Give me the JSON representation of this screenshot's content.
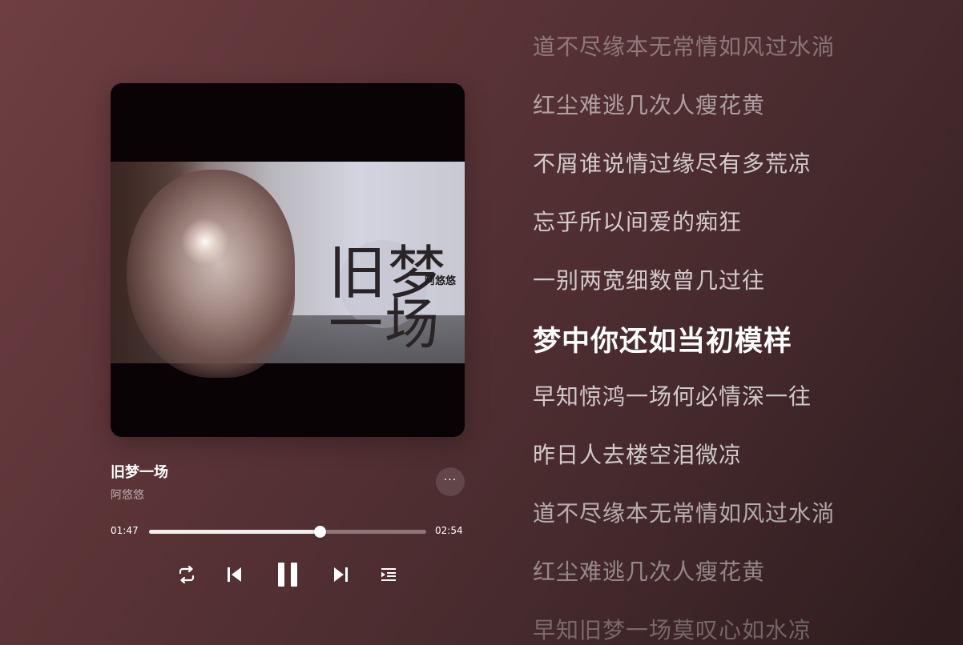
{
  "album_art": {
    "title_line1": "旧梦",
    "title_line2": "一场",
    "artist": "阿悠悠"
  },
  "song": {
    "title": "旧梦一场",
    "artist": "阿悠悠",
    "more_label": "···"
  },
  "progress": {
    "current": "01:47",
    "total": "02:54",
    "fraction": 0.615
  },
  "controls": {
    "repeat_icon": "repeat-icon",
    "prev_icon": "skip-previous-icon",
    "play_pause_icon": "pause-icon",
    "next_icon": "skip-next-icon",
    "queue_icon": "playlist-icon"
  },
  "lyrics": {
    "active_index": 5,
    "lines": [
      "道不尽缘本无常情如风过水淌",
      "红尘难逃几次人瘦花黄",
      "不屑谁说情过缘尽有多荒凉",
      "忘乎所以间爱的痴狂",
      "一别两宽细数曾几过往",
      "梦中你还如当初模样",
      "早知惊鸿一场何必情深一往",
      "昨日人去楼空泪微凉",
      "道不尽缘本无常情如风过水淌",
      "红尘难逃几次人瘦花黄",
      "早知旧梦一场莫叹心如水凉"
    ]
  },
  "colors": {
    "background_start": "#6e3e42",
    "background_end": "#2d1b1d",
    "text_primary": "#ffffff"
  }
}
